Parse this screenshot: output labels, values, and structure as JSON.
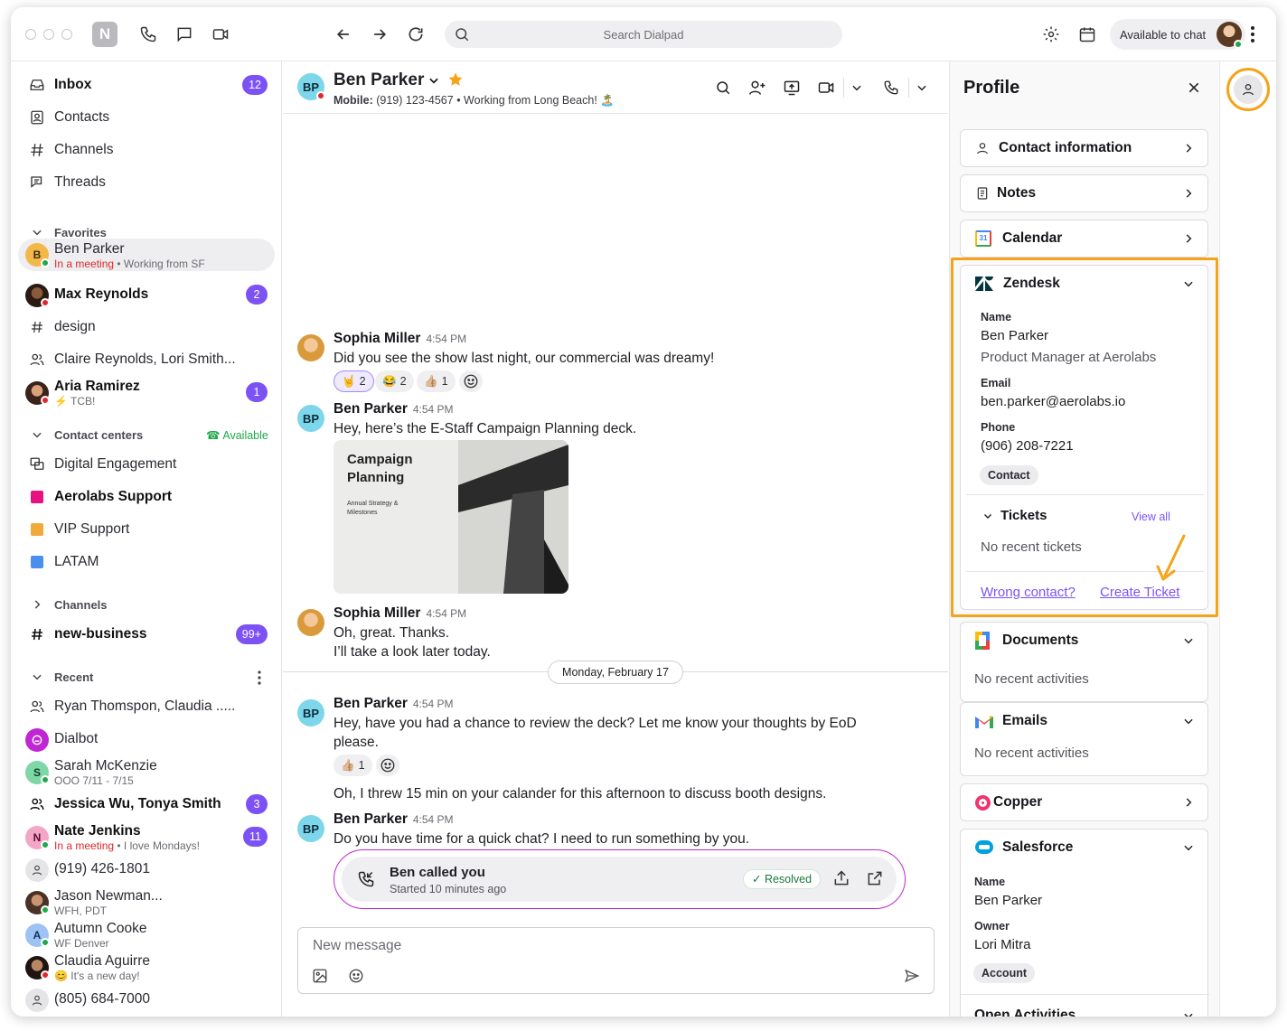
{
  "titlebar": {
    "search_placeholder": "Search Dialpad",
    "status": "Available to chat",
    "app_logo": "N"
  },
  "sidebar": {
    "nav": [
      {
        "label": "Inbox",
        "badge": "12",
        "icon": "inbox-icon"
      },
      {
        "label": "Contacts",
        "icon": "contacts-icon"
      },
      {
        "label": "Channels",
        "icon": "hash-icon"
      },
      {
        "label": "Threads",
        "icon": "threads-icon"
      }
    ],
    "favorites_header": "Favorites",
    "favorites": [
      {
        "label": "Ben Parker",
        "initials": "B",
        "status": "In a meeting",
        "sub": "Working from SF"
      },
      {
        "label": "Max Reynolds",
        "badge": "2"
      },
      {
        "label": "design"
      },
      {
        "label": "Claire Reynolds, Lori Smith..."
      },
      {
        "label": "Aria Ramirez",
        "sub": "⚡ TCB!",
        "badge": "1"
      }
    ],
    "contact_centers_header": "Contact centers",
    "contact_centers_status": "Available",
    "contact_centers": [
      {
        "label": "Digital Engagement"
      },
      {
        "label": "Aerolabs Support",
        "color": "#e6127d"
      },
      {
        "label": "VIP Support",
        "color": "#f2a93b"
      },
      {
        "label": "LATAM",
        "color": "#4a8ff0"
      }
    ],
    "channels_header": "Channels",
    "channels": [
      {
        "label": "new-business",
        "badge": "99+"
      }
    ],
    "recent_header": "Recent",
    "recent": [
      {
        "label": "Ryan Thomspon, Claudia ....."
      },
      {
        "label": "Dialbot"
      },
      {
        "label": "Sarah McKenzie",
        "initials": "S",
        "sub": "OOO 7/11 - 7/15"
      },
      {
        "label": "Jessica Wu, Tonya Smith",
        "badge": "3"
      },
      {
        "label": "Nate Jenkins",
        "initials": "N",
        "status": "In a meeting",
        "sub": "I love Mondays!",
        "badge": "11"
      },
      {
        "label": "(919) 426-1801"
      },
      {
        "label": "Jason Newman...",
        "sub": "WFH, PDT"
      },
      {
        "label": "Autumn Cooke",
        "initials": "A",
        "sub": "WF Denver"
      },
      {
        "label": "Claudia Aguirre",
        "sub": "😊 It's a new day!"
      },
      {
        "label": "(805) 684-7000"
      }
    ]
  },
  "chat": {
    "contact_name": "Ben Parker",
    "initials": "BP",
    "mobile_label": "Mobile:",
    "mobile": "(919) 123-4567",
    "status": "Working from Long Beach! 🏝️",
    "messages": [
      {
        "name": "Sophia Miller",
        "time": "4:54 PM",
        "text": "Did you see the show last night, our commercial was dreamy!"
      },
      {
        "name": "Ben Parker",
        "time": "4:54 PM",
        "text": "Hey, here’s the E-Staff Campaign Planning deck."
      },
      {
        "name": "Sophia Miller",
        "time": "4:54 PM",
        "text": "Oh, great. Thanks.",
        "text2": "I’ll take a look later today."
      },
      {
        "name": "Ben Parker",
        "time": "4:54 PM",
        "text": "Hey, have you had a chance to review the deck? Let me know your thoughts by EoD",
        "text2": "please.",
        "text3": "Oh, I threw 15 min on your calander for this afternoon to discuss booth designs."
      },
      {
        "name": "Ben Parker",
        "time": "4:54 PM",
        "text": "Do you have time for a quick chat? I need to run something by you."
      }
    ],
    "reactions1": [
      {
        "emoji": "🤘",
        "count": "2"
      },
      {
        "emoji": "😂",
        "count": "2"
      },
      {
        "emoji": "👍🏼",
        "count": "1"
      }
    ],
    "reactions2": [
      {
        "emoji": "👍🏼",
        "count": "1"
      }
    ],
    "deck": {
      "title_line1": "Campaign",
      "title_line2": "Planning",
      "subtitle_line1": "Annual Strategy &",
      "subtitle_line2": "Milestones"
    },
    "date_divider": "Monday, February 17",
    "call": {
      "title": "Ben called you",
      "sub": "Started 10 minutes ago",
      "status": "Resolved"
    },
    "composer_placeholder": "New message"
  },
  "profile": {
    "title": "Profile",
    "cards": {
      "contact_info": "Contact information",
      "notes": "Notes",
      "calendar": "Calendar",
      "zendesk": "Zendesk",
      "documents": "Documents",
      "emails": "Emails",
      "copper": "Copper",
      "salesforce": "Salesforce",
      "open_activities": "Open Activities"
    },
    "zendesk": {
      "name_label": "Name",
      "name": "Ben Parker",
      "role": "Product Manager at Aerolabs",
      "email_label": "Email",
      "email": "ben.parker@aerolabs.io",
      "phone_label": "Phone",
      "phone": "(906) 208-7221",
      "tag": "Contact",
      "tickets_label": "Tickets",
      "view_all": "View all",
      "no_tickets": "No recent tickets",
      "wrong_contact": "Wrong contact?",
      "create_ticket": "Create Ticket"
    },
    "documents_empty": "No recent activities",
    "emails_empty": "No recent activities",
    "salesforce": {
      "name_label": "Name",
      "name": "Ben Parker",
      "owner_label": "Owner",
      "owner": "Lori Mitra",
      "tag": "Account"
    }
  },
  "colors": {
    "accent": "#7c52f4",
    "highlight": "#f5a31a",
    "danger": "#e0262d",
    "online": "#1fa84a"
  }
}
